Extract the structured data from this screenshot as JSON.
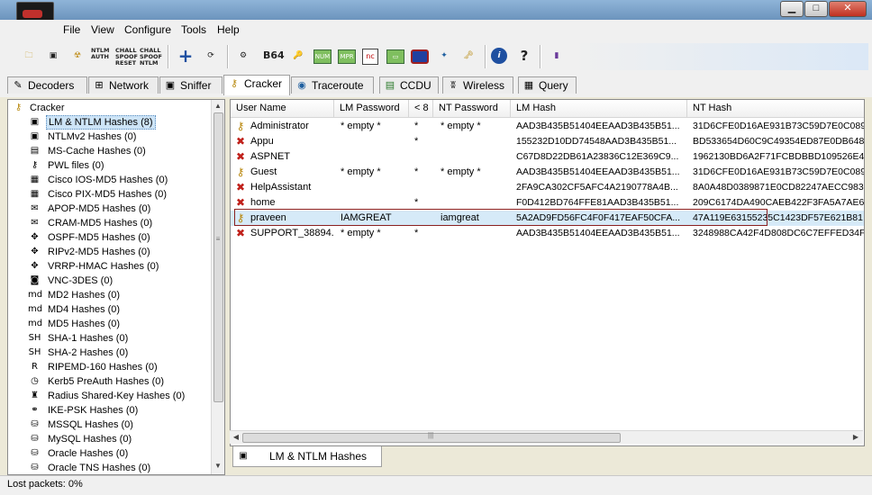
{
  "menu": [
    "File",
    "View",
    "Configure",
    "Tools",
    "Help"
  ],
  "window_controls": {
    "minimize": "▁",
    "maximize": "□",
    "close": "✕"
  },
  "toolbar": {
    "ntlm_auth_label": "NTLM AUTH",
    "chall_spoof_reset_label": "CHALL SPOOF RESET",
    "chall_spoof_ntlm_label": "CHALL SPOOF NTLM",
    "base64_label": "B64"
  },
  "tabs": [
    {
      "label": "Decoders",
      "icon": "decoders-icon"
    },
    {
      "label": "Network",
      "icon": "network-icon"
    },
    {
      "label": "Sniffer",
      "icon": "sniffer-icon"
    },
    {
      "label": "Cracker",
      "icon": "cracker-key-icon",
      "active": true
    },
    {
      "label": "Traceroute",
      "icon": "traceroute-icon"
    },
    {
      "label": "CCDU",
      "icon": "ccdu-icon"
    },
    {
      "label": "Wireless",
      "icon": "wireless-icon"
    },
    {
      "label": "Query",
      "icon": "query-icon"
    }
  ],
  "tree": {
    "root": "Cracker",
    "items": [
      {
        "label": "LM & NTLM Hashes (8)",
        "icon": "lm-ntlm-icon",
        "selected": true
      },
      {
        "label": "NTLMv2 Hashes (0)",
        "icon": "ntlmv2-icon"
      },
      {
        "label": "MS-Cache Hashes (0)",
        "icon": "ms-cache-icon"
      },
      {
        "label": "PWL files (0)",
        "icon": "pwl-key-icon"
      },
      {
        "label": "Cisco IOS-MD5 Hashes (0)",
        "icon": "cisco-ios-icon"
      },
      {
        "label": "Cisco PIX-MD5 Hashes (0)",
        "icon": "cisco-pix-icon"
      },
      {
        "label": "APOP-MD5 Hashes (0)",
        "icon": "apop-icon"
      },
      {
        "label": "CRAM-MD5 Hashes (0)",
        "icon": "cram-icon"
      },
      {
        "label": "OSPF-MD5 Hashes (0)",
        "icon": "ospf-arrows-icon"
      },
      {
        "label": "RIPv2-MD5 Hashes (0)",
        "icon": "ripv2-arrows-icon"
      },
      {
        "label": "VRRP-HMAC Hashes (0)",
        "icon": "vrrp-arrows-icon"
      },
      {
        "label": "VNC-3DES (0)",
        "icon": "vnc-icon"
      },
      {
        "label": "MD2 Hashes (0)",
        "icon": "md2-icon"
      },
      {
        "label": "MD4 Hashes (0)",
        "icon": "md4-icon"
      },
      {
        "label": "MD5 Hashes (0)",
        "icon": "md5-icon"
      },
      {
        "label": "SHA-1 Hashes (0)",
        "icon": "sha1-icon"
      },
      {
        "label": "SHA-2 Hashes (0)",
        "icon": "sha2-icon"
      },
      {
        "label": "RIPEMD-160 Hashes (0)",
        "icon": "ripemd-icon"
      },
      {
        "label": "Kerb5 PreAuth Hashes (0)",
        "icon": "kerb5-clock-icon"
      },
      {
        "label": "Radius Shared-Key Hashes (0)",
        "icon": "radius-icon"
      },
      {
        "label": "IKE-PSK Hashes (0)",
        "icon": "ike-psk-icon"
      },
      {
        "label": "MSSQL Hashes (0)",
        "icon": "mssql-db-icon"
      },
      {
        "label": "MySQL Hashes (0)",
        "icon": "mysql-db-icon"
      },
      {
        "label": "Oracle Hashes (0)",
        "icon": "oracle-db-icon"
      },
      {
        "label": "Oracle TNS Hashes (0)",
        "icon": "oracle-tns-db-icon"
      }
    ]
  },
  "table": {
    "columns": [
      "User Name",
      "LM Password",
      "< 8",
      "NT Password",
      "LM Hash",
      "NT Hash"
    ],
    "rows": [
      {
        "icon": "key",
        "user": "Administrator",
        "lm_pw": "* empty *",
        "lt8": "*",
        "nt_pw": "* empty *",
        "lm_hash": "AAD3B435B51404EEAAD3B435B51...",
        "nt_hash": "31D6CFE0D16AE931B73C59D7E0C089"
      },
      {
        "icon": "x",
        "user": "Appu",
        "lm_pw": "",
        "lt8": "*",
        "nt_pw": "",
        "lm_hash": "155232D10DD74548AAD3B435B51...",
        "nt_hash": "BD533654D60C9C49354ED87E0DB648"
      },
      {
        "icon": "x",
        "user": "ASPNET",
        "lm_pw": "",
        "lt8": "",
        "nt_pw": "",
        "lm_hash": "C67D8D22DB61A23836C12E369C9...",
        "nt_hash": "1962130BD6A2F71FCBDBBD109526E4"
      },
      {
        "icon": "key",
        "user": "Guest",
        "lm_pw": "* empty *",
        "lt8": "*",
        "nt_pw": "* empty *",
        "lm_hash": "AAD3B435B51404EEAAD3B435B51...",
        "nt_hash": "31D6CFE0D16AE931B73C59D7E0C089"
      },
      {
        "icon": "x",
        "user": "HelpAssistant",
        "lm_pw": "",
        "lt8": "",
        "nt_pw": "",
        "lm_hash": "2FA9CA302CF5AFC4A2190778A4B...",
        "nt_hash": "8A0A48D0389871E0CD82247AECC983"
      },
      {
        "icon": "x",
        "user": "home",
        "lm_pw": "",
        "lt8": "*",
        "nt_pw": "",
        "lm_hash": "F0D412BD764FFE81AAD3B435B51...",
        "nt_hash": "209C6174DA490CAEB422F3FA5A7AE6"
      },
      {
        "icon": "key",
        "user": "praveen",
        "lm_pw": "IAMGREAT",
        "lt8": "",
        "nt_pw": "iamgreat",
        "lm_hash": "5A2AD9FD56FC4F0F417EAF50CFA...",
        "nt_hash": "47A119E63155235C1423DF57E621B81",
        "selected": true
      },
      {
        "icon": "x",
        "user": "SUPPORT_38894...",
        "lm_pw": "* empty *",
        "lt8": "*",
        "nt_pw": "",
        "lm_hash": "AAD3B435B51404EEAAD3B435B51...",
        "nt_hash": "3248988CA42F4D808DC6C7EFFED34F"
      }
    ]
  },
  "bottom_tab": {
    "label": "LM & NTLM Hashes",
    "icon": "lm-ntlm-icon"
  },
  "status": {
    "text": "Lost packets:  0%"
  }
}
